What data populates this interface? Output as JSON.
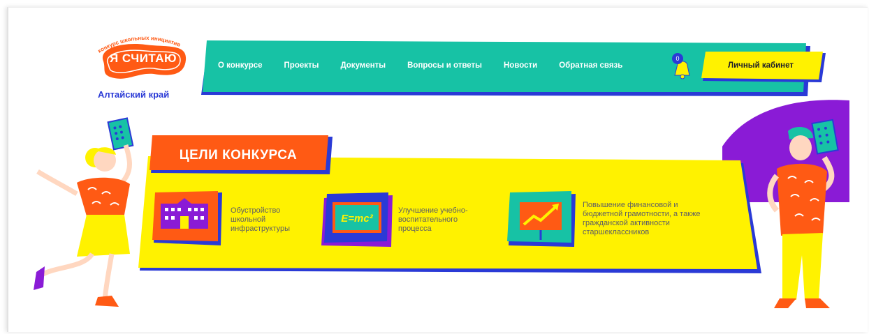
{
  "logo": {
    "arc_text": "конкурс школьных инициатив",
    "main_text": "Я СЧИТАЮ",
    "region": "Алтайский край"
  },
  "nav": {
    "items": [
      "О конкурсе",
      "Проекты",
      "Документы",
      "Вопросы и ответы",
      "Новости",
      "Обратная связь"
    ],
    "notification_count": "0",
    "cabinet_label": "Личный кабинет"
  },
  "goals": {
    "title": "ЦЕЛИ КОНКУРСА",
    "items": [
      {
        "icon": "school-building-icon",
        "lines": [
          "Обустройство",
          "школьной",
          "инфраструктуры"
        ]
      },
      {
        "icon": "formula-board-icon",
        "formula": "E=mc²",
        "lines": [
          "Улучшение учебно-",
          "воспитательного",
          "процесса"
        ]
      },
      {
        "icon": "growth-chart-icon",
        "lines": [
          "Повышение финансовой и",
          "бюджетной грамотности, а также",
          "гражданской активности",
          "старшеклассников"
        ]
      }
    ]
  },
  "colors": {
    "teal": "#17c2a5",
    "yellow": "#fff200",
    "orange": "#ff5a14",
    "purple": "#8a1bd6",
    "blue": "#2a3ad6"
  }
}
